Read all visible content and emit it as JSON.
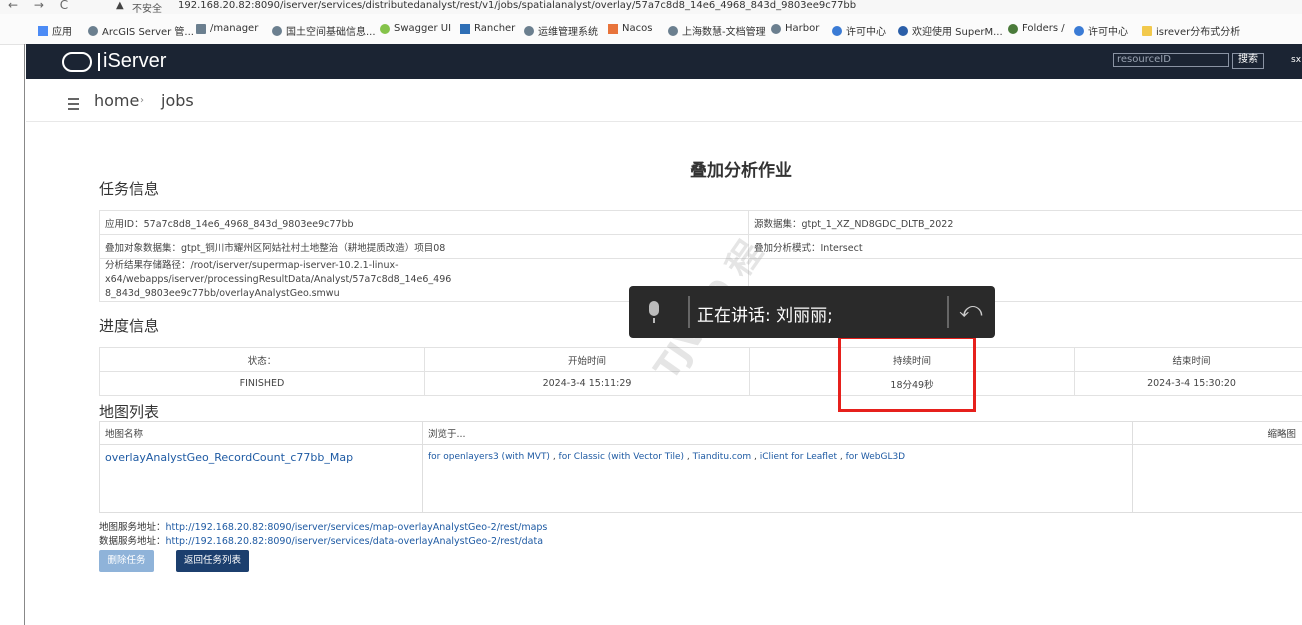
{
  "browser": {
    "nav_glyphs": "← → C",
    "insecure_label": "不安全",
    "url": "192.168.20.82:8090/iserver/services/distributedanalyst/rest/v1/jobs/spatialanalyst/overlay/57a7c8d8_14e6_4968_843d_9803ee9c77bb",
    "bookmarks": [
      "应用",
      "ArcGIS Server 管...",
      "/manager",
      "国土空间基础信息...",
      "Swagger UI",
      "Rancher",
      "运维管理系统",
      "Nacos",
      "上海数慧-文档管理",
      "Harbor",
      "许可中心",
      "欢迎使用 SuperM...",
      "Folders /",
      "许可中心",
      "isrever分布式分析"
    ]
  },
  "header": {
    "logo_text": "iServer",
    "search_placeholder": "resourceID",
    "search_button": "搜索",
    "user_initial": "sx"
  },
  "breadcrumb": {
    "home": "home",
    "separator": "›",
    "current": "jobs"
  },
  "page_title": "叠加分析作业",
  "task_info": {
    "section_title": "任务信息",
    "app_id": "应用ID：57a7c8d8_14e6_4968_843d_9803ee9c77bb",
    "source_dataset": "源数据集：gtpt_1_XZ_ND8GDC_DLTB_2022",
    "overlay_dataset": "叠加对象数据集：gtpt_铜川市耀州区阿姑社村土地整治（耕地提质改造）项目08",
    "overlay_mode": "叠加分析模式：Intersect",
    "result_path_line1": "分析结果存储路径：/root/iserver/supermap-iserver-10.2.1-linux-x64/webapps/iserver/processingResultData/Analyst/57a7c8d8_14e6_496",
    "result_path_line2": "8_843d_9803ee9c77bb/overlayAnalystGeo.smwu"
  },
  "progress": {
    "section_title": "进度信息",
    "headers": [
      "状态：",
      "开始时间",
      "持续时间",
      "结束时间"
    ],
    "values": [
      "FINISHED",
      "2024-3-4 15:11:29",
      "18分49秒",
      "2024-3-4 15:30:20"
    ]
  },
  "map_list": {
    "section_title": "地图列表",
    "headers": [
      "地图名称",
      "浏览于...",
      "缩略图"
    ],
    "map_name": "overlayAnalystGeo_RecordCount_c77bb_Map",
    "browse_links": [
      "for openlayers3 (with MVT)",
      "for Classic (with Vector Tile)",
      "Tianditu.com",
      "iClient for Leaflet",
      "for WebGL3D"
    ],
    "link_separator": " , "
  },
  "footer": {
    "map_service_label": "地图服务地址：",
    "map_service_url": "http://192.168.20.82:8090/iserver/services/map-overlayAnalystGeo-2/rest/maps",
    "data_service_label": "数据服务地址：",
    "data_service_url": "http://192.168.20.82:8090/iserver/services/data-overlayAnalystGeo-2/rest/data",
    "delete_button": "删除任务",
    "back_button": "返回任务列表"
  },
  "voice_overlay": {
    "text": "正在讲话: 刘丽丽;"
  },
  "watermark": "TJVG9 程",
  "colors": {
    "header_bg": "#1b2433",
    "link": "#1e5aa3",
    "highlight": "#e6201c",
    "delete_btn": "#8fb3d9",
    "back_btn": "#1c3f6e"
  }
}
